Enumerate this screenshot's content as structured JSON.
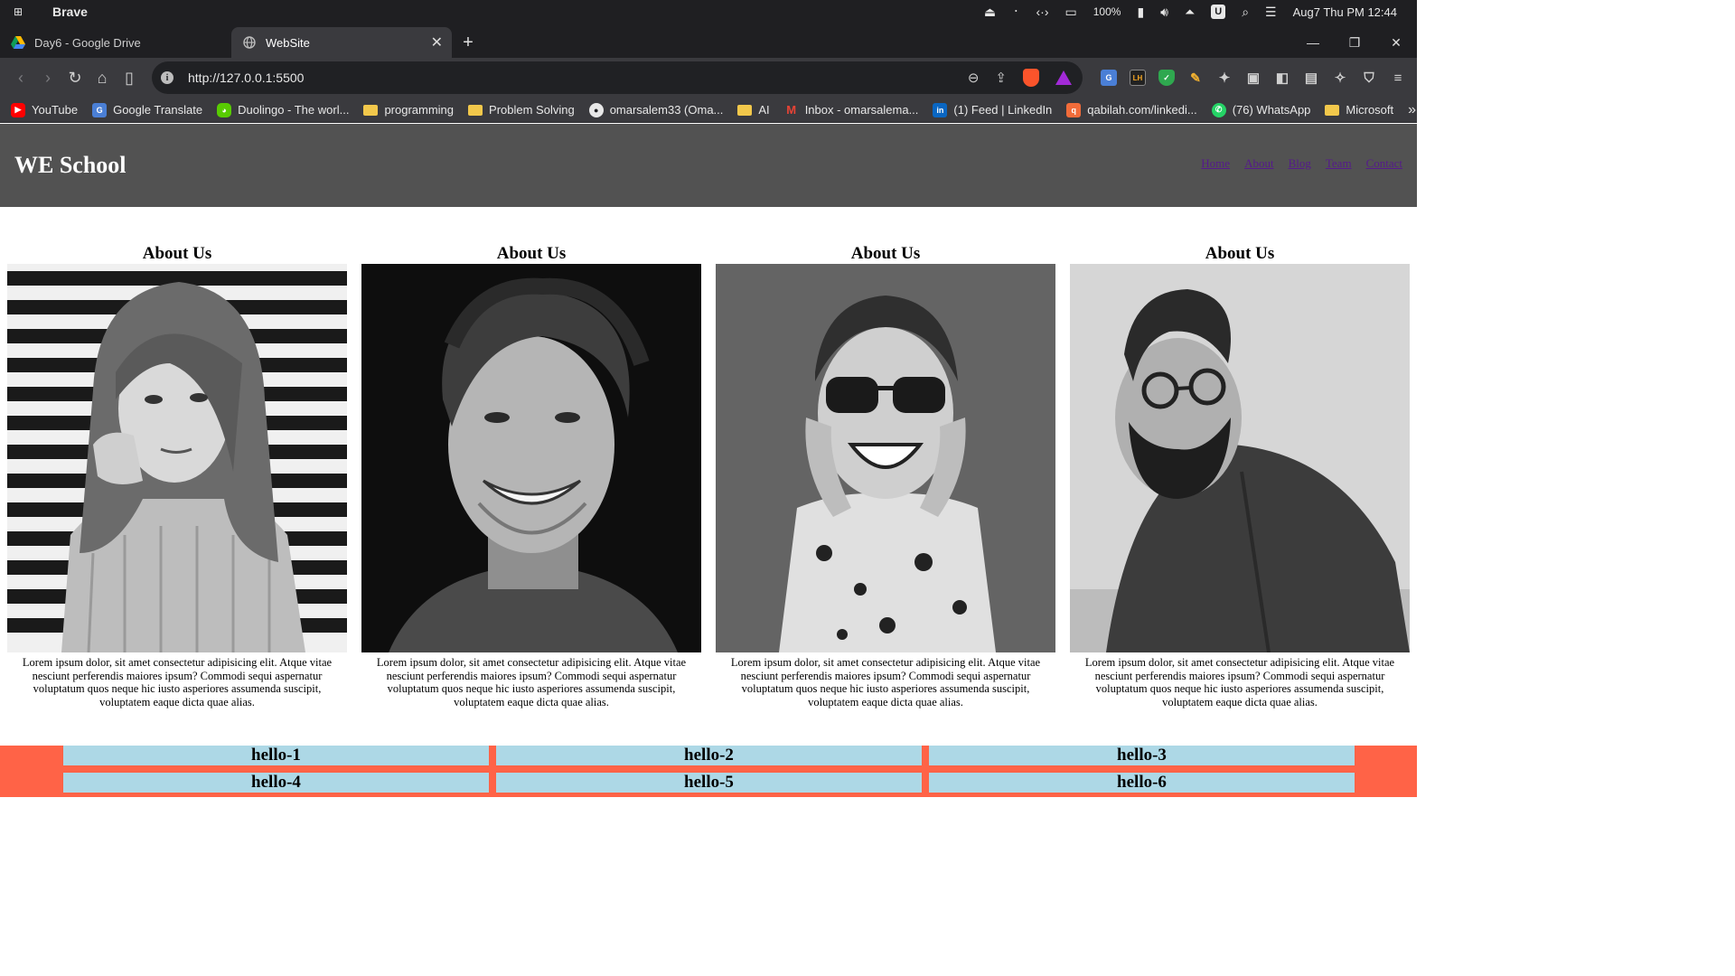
{
  "os": {
    "app_name": "Brave",
    "battery": "100%",
    "clock": "Aug7 Thu PM 12:44",
    "user_badge": "U"
  },
  "tabs": [
    {
      "title": "Day6 - Google Drive",
      "icon": "google-drive-icon",
      "active": false
    },
    {
      "title": "WebSite",
      "icon": "globe-icon",
      "active": true
    }
  ],
  "toolbar": {
    "url": "http://127.0.0.1:5500"
  },
  "bookmarks": [
    {
      "label": "YouTube",
      "icon": "youtube-icon"
    },
    {
      "label": "Google Translate",
      "icon": "google-translate-icon"
    },
    {
      "label": "Duolingo - The worl...",
      "icon": "duolingo-icon"
    },
    {
      "label": "programming",
      "icon": "folder-icon"
    },
    {
      "label": "Problem Solving",
      "icon": "folder-icon"
    },
    {
      "label": "omarsalem33 (Oma...",
      "icon": "github-icon"
    },
    {
      "label": "AI",
      "icon": "folder-icon"
    },
    {
      "label": "Inbox - omarsalema...",
      "icon": "gmail-icon"
    },
    {
      "label": "(1) Feed | LinkedIn",
      "icon": "linkedin-icon"
    },
    {
      "label": "qabilah.com/linkedi...",
      "icon": "qabilah-icon"
    },
    {
      "label": "(76) WhatsApp",
      "icon": "whatsapp-icon"
    },
    {
      "label": "Microsoft",
      "icon": "folder-icon"
    }
  ],
  "site": {
    "logo": "WE School",
    "nav": [
      "Home",
      "About",
      "Blog",
      "Team",
      "Contact"
    ],
    "cards": [
      {
        "heading": "About Us",
        "text": "Lorem ipsum dolor, sit amet consectetur adipisicing elit. Atque vitae nesciunt perferendis maiores ipsum? Commodi sequi aspernatur voluptatum quos neque hic iusto asperiores assumenda suscipit, voluptatem eaque dicta quae alias."
      },
      {
        "heading": "About Us",
        "text": "Lorem ipsum dolor, sit amet consectetur adipisicing elit. Atque vitae nesciunt perferendis maiores ipsum? Commodi sequi aspernatur voluptatum quos neque hic iusto asperiores assumenda suscipit, voluptatem eaque dicta quae alias."
      },
      {
        "heading": "About Us",
        "text": "Lorem ipsum dolor, sit amet consectetur adipisicing elit. Atque vitae nesciunt perferendis maiores ipsum? Commodi sequi aspernatur voluptatum quos neque hic iusto asperiores assumenda suscipit, voluptatem eaque dicta quae alias."
      },
      {
        "heading": "About Us",
        "text": "Lorem ipsum dolor, sit amet consectetur adipisicing elit. Atque vitae nesciunt perferendis maiores ipsum? Commodi sequi aspernatur voluptatum quos neque hic iusto asperiores assumenda suscipit, voluptatem eaque dicta quae alias."
      }
    ],
    "grid": [
      "hello-1",
      "hello-2",
      "hello-3",
      "hello-4",
      "hello-5",
      "hello-6"
    ]
  },
  "colors": {
    "header_bg": "#525252",
    "grid_bg": "#ff6347",
    "cell_bg": "#add8e6",
    "link": "#551a8b"
  }
}
